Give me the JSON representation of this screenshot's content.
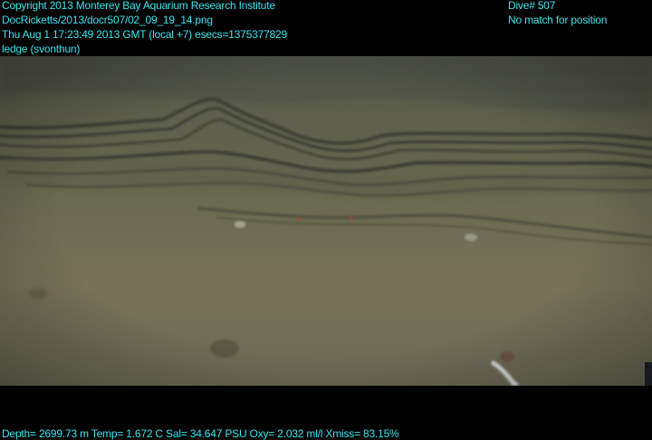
{
  "header": {
    "left_lines": [
      "Copyright 2013 Monterey Bay Aquarium Research Institute",
      "DocRicketts/2013/docr507/02_09_19_14.png",
      "Thu Aug  1 17:23:49 2013 GMT (local +7)  esecs=1375377829",
      "ledge (svonthun)"
    ],
    "right_lines": [
      "Dive# 507",
      "No match for position"
    ]
  },
  "footer": {
    "telemetry": "Depth= 2699.73 m  Temp= 1.672 C  Sal= 34.647 PSU  Oxy= 2.032 ml/l  Xmiss= 83.15%"
  },
  "colors": {
    "overlay_text": "#35e6ef",
    "background": "#000000",
    "sediment": "#6f6c57"
  }
}
